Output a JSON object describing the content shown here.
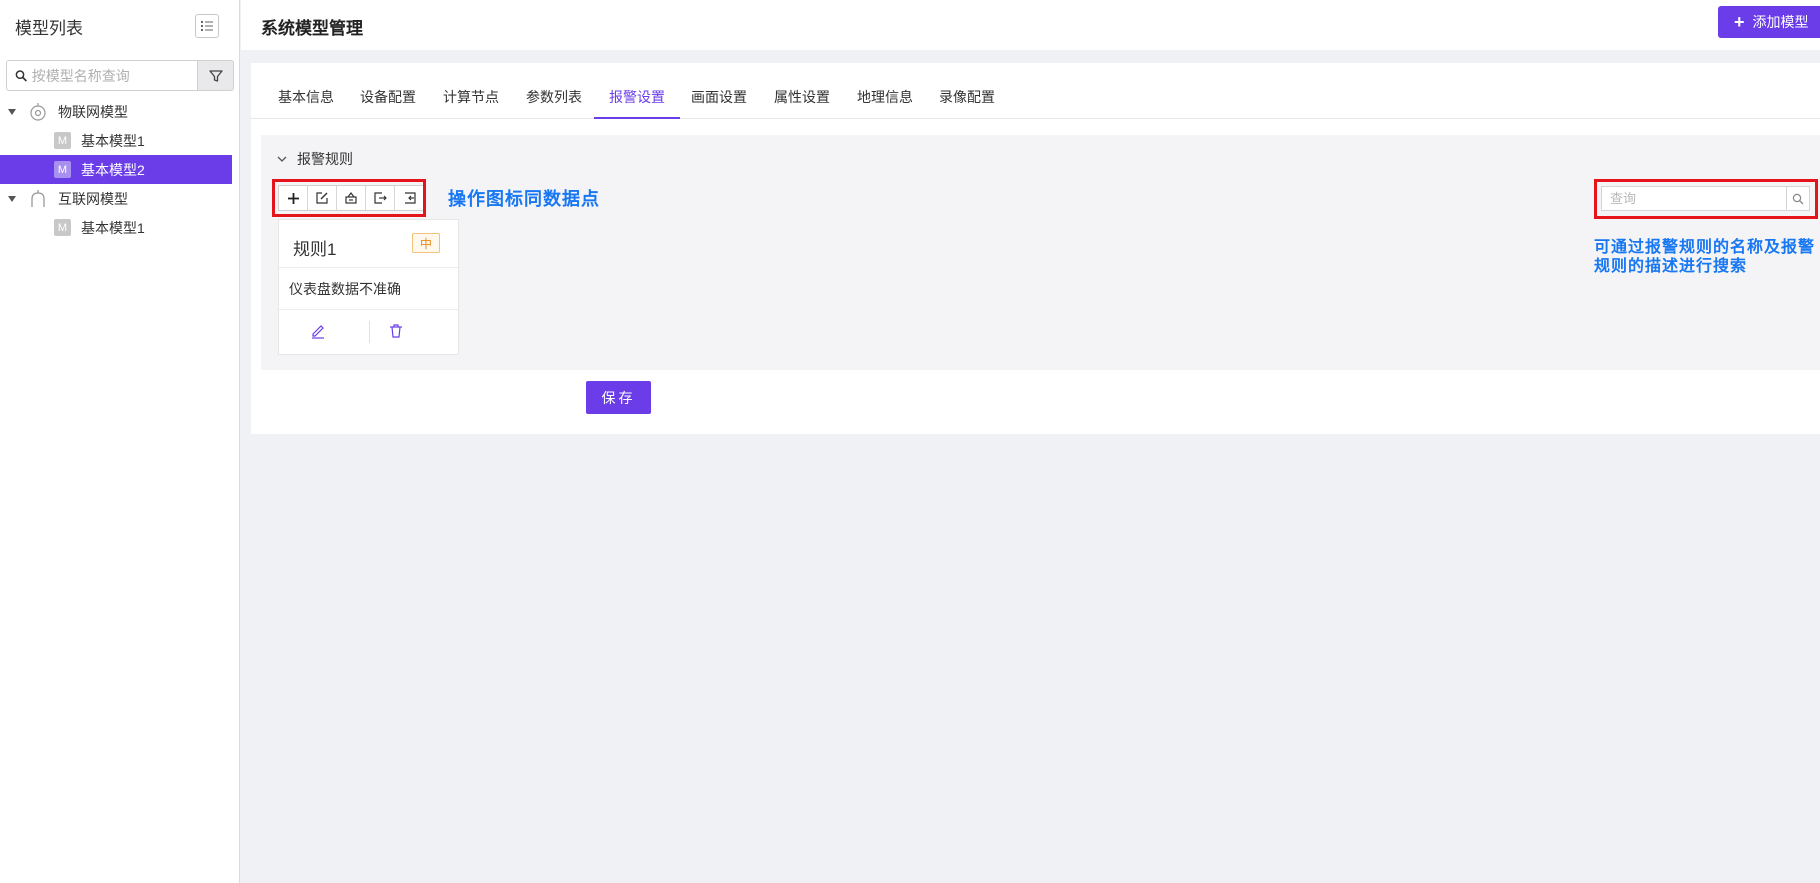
{
  "sidebar": {
    "title": "模型列表",
    "search_placeholder": "按模型名称查询",
    "tree": [
      {
        "label": "物联网模型",
        "icon": "iot-icon",
        "children": [
          "基本模型1",
          "基本模型2"
        ]
      },
      {
        "label": "互联网模型",
        "icon": "internet-icon",
        "children": [
          "基本模型1"
        ]
      }
    ],
    "selected": "基本模型2",
    "leaf_icon_letter": "M"
  },
  "header": {
    "title": "系统模型管理",
    "add_button": "添加模型"
  },
  "tabs": [
    "基本信息",
    "设备配置",
    "计算节点",
    "参数列表",
    "报警设置",
    "画面设置",
    "属性设置",
    "地理信息",
    "录像配置"
  ],
  "active_tab": "报警设置",
  "rules": {
    "section_title": "报警规则",
    "toolbar_icons": [
      "add-icon",
      "edit-icon",
      "import-icon",
      "export-icon",
      "export-all-icon"
    ],
    "search_placeholder": "查询",
    "cards": [
      {
        "title": "规则1",
        "level": "中",
        "description": "仪表盘数据不准确"
      }
    ]
  },
  "annotations": {
    "toolbar_note": "操作图标同数据点",
    "search_note": "可通过报警规则的名称及报警规则的描述进行搜索"
  },
  "save_button": "保存",
  "colors": {
    "accent": "#6a3de8",
    "annotation_box": "#e5131a",
    "annotation_text": "#1877f2",
    "level_medium": "#e88a1a"
  }
}
